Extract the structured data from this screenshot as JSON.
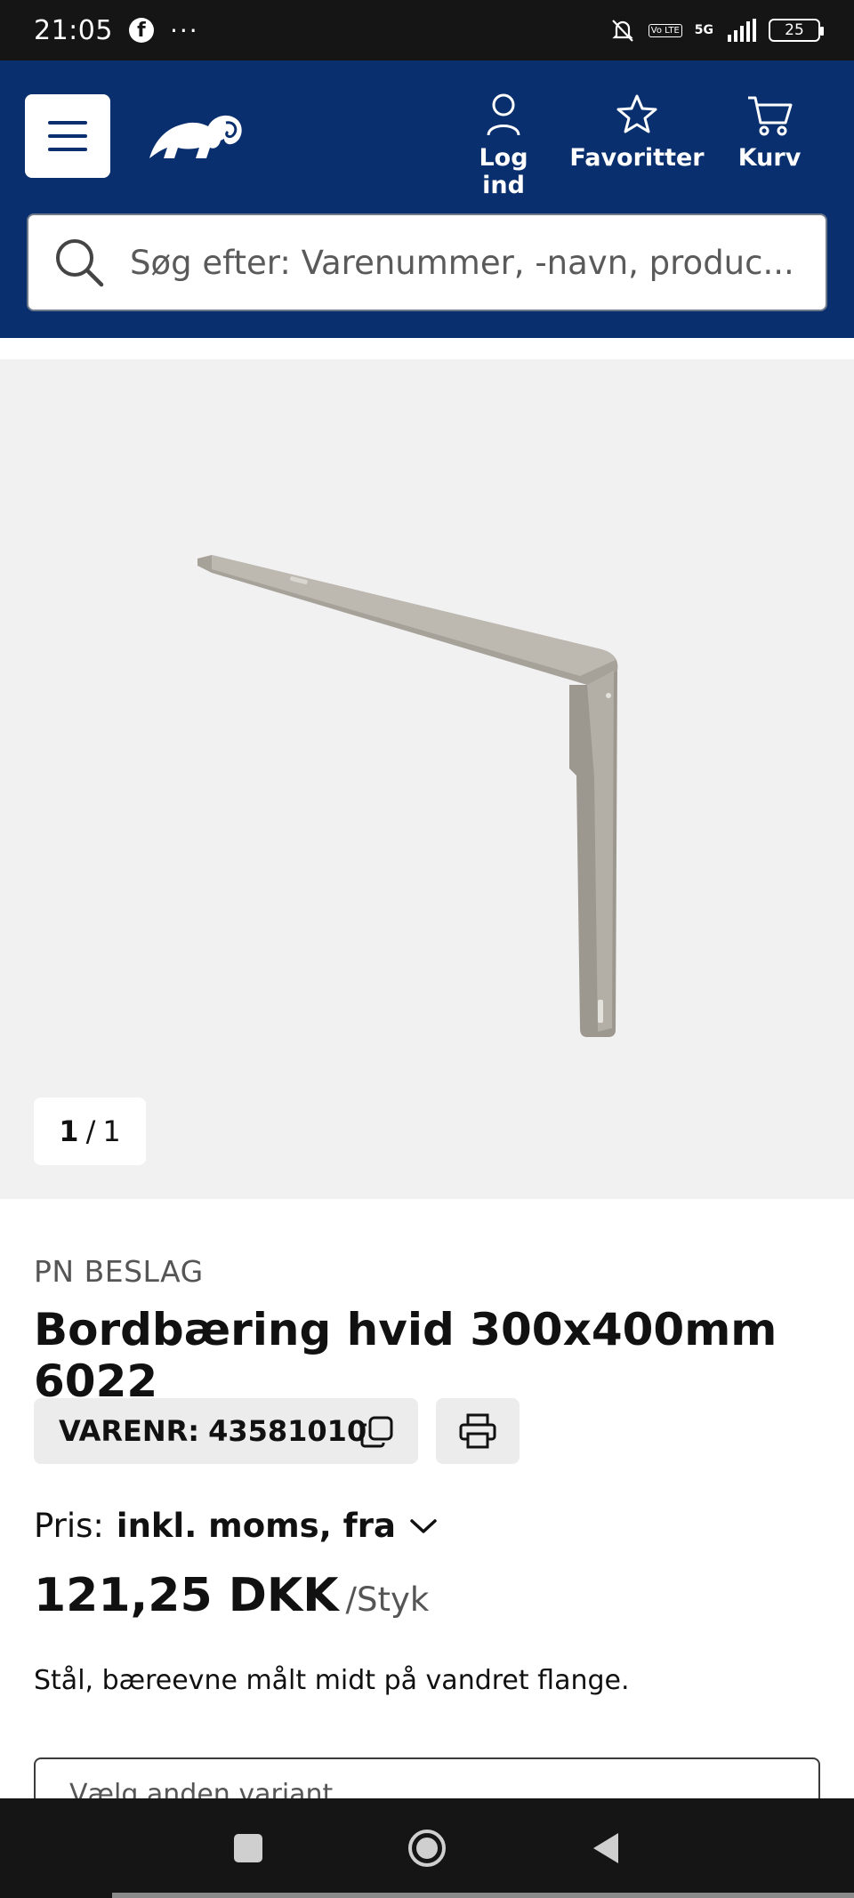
{
  "status_bar": {
    "time": "21:05",
    "facebook_icon": "f",
    "overflow": "···",
    "network": "5G",
    "volte": "Vo LTE",
    "battery": "25"
  },
  "header": {
    "menu_icon": "hamburger-icon",
    "logo_icon": "ram-logo-icon",
    "nav": {
      "login": "Log ind",
      "favorites": "Favoritter",
      "cart": "Kurv"
    },
    "search": {
      "placeholder": "Søg efter: Varenummer, -navn, produc..."
    }
  },
  "gallery": {
    "current": "1",
    "separator": "/",
    "total": "1",
    "image": "shelf-bracket"
  },
  "product": {
    "brand": "PN BESLAG",
    "title": "Bordbæring hvid 300x400mm 6022",
    "sku_label": "VARENR:",
    "sku_value": "43581010",
    "price_label": "Pris:",
    "price_mode": "inkl. moms, fra",
    "price": "121,25 DKK",
    "unit": "/Styk",
    "description": "Stål, bæreevne målt midt på vandret flange.",
    "variant_label": "Vælg anden variant"
  },
  "colors": {
    "header_bg": "#0a2f6e",
    "gallery_bg": "#f1f1f1",
    "chip_bg": "#ececec",
    "system_bar": "#151515"
  }
}
